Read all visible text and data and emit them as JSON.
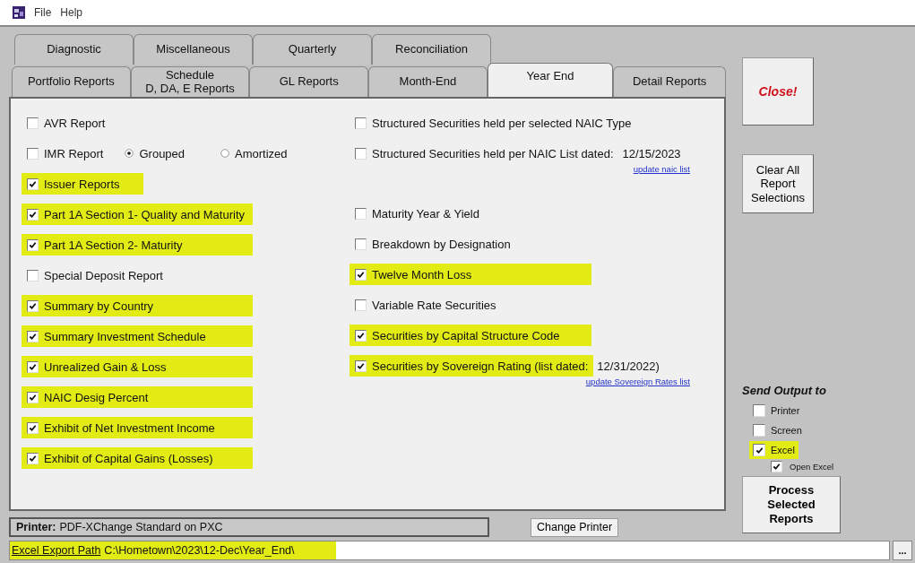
{
  "menu": [
    "File",
    "Help"
  ],
  "tabs": {
    "row_1": [
      {
        "label": "Diagnostic",
        "selected": false
      },
      {
        "label": "Miscellaneous",
        "selected": false
      },
      {
        "label": "Quarterly",
        "selected": false
      },
      {
        "label": "Reconciliation",
        "selected": false
      }
    ],
    "row_2": [
      {
        "label": "Portfolio Reports",
        "selected": false
      },
      {
        "label": "Schedule\nD, DA, E Reports",
        "selected": false
      },
      {
        "label": "GL Reports",
        "selected": false
      },
      {
        "label": "Month-End",
        "selected": false
      },
      {
        "label": "Year End",
        "selected": true
      },
      {
        "label": "Detail Reports",
        "selected": false
      }
    ]
  },
  "reports_left": [
    {
      "kind": "checkbox",
      "label": "AVR Report",
      "checked": false,
      "highlighted": false
    },
    {
      "kind": "radios",
      "label": "IMR Report",
      "checked": false,
      "highlighted": false,
      "options": [
        {
          "label": "Grouped",
          "selected": true
        },
        {
          "label": "Amortized",
          "selected": false
        }
      ]
    },
    {
      "kind": "checkbox",
      "label": "Issuer Reports",
      "checked": true,
      "highlighted": true
    },
    {
      "kind": "checkbox",
      "label": "Part 1A Section 1- Quality and Maturity",
      "checked": true,
      "highlighted": true
    },
    {
      "kind": "checkbox",
      "label": "Part 1A Section 2- Maturity",
      "checked": true,
      "highlighted": true
    },
    {
      "kind": "checkbox",
      "label": "Special Deposit Report",
      "checked": false,
      "highlighted": false
    },
    {
      "kind": "checkbox",
      "label": "Summary by Country",
      "checked": true,
      "highlighted": true
    },
    {
      "kind": "checkbox",
      "label": "Summary Investment Schedule",
      "checked": true,
      "highlighted": true
    },
    {
      "kind": "checkbox",
      "label": "Unrealized Gain & Loss",
      "checked": true,
      "highlighted": true
    },
    {
      "kind": "checkbox",
      "label": "NAIC Desig Percent",
      "checked": true,
      "highlighted": true
    },
    {
      "kind": "checkbox",
      "label": "Exhibit of Net Investment Income",
      "checked": true,
      "highlighted": true
    },
    {
      "kind": "checkbox",
      "label": "Exhibit of Capital Gains (Losses)",
      "checked": true,
      "highlighted": true
    }
  ],
  "reports_right": [
    {
      "kind": "checkbox",
      "label": "Structured Securities held per selected NAIC Type",
      "checked": false,
      "highlighted": false
    },
    {
      "kind": "checkbox",
      "label": "Structured Securities held per NAIC List dated:",
      "date": "12/15/2023",
      "link": "update naic list",
      "checked": false,
      "highlighted": false
    },
    {
      "kind": "checkbox",
      "label": "Maturity Year & Yield",
      "checked": false,
      "highlighted": false
    },
    {
      "kind": "checkbox",
      "label": "Breakdown by Designation",
      "checked": false,
      "highlighted": false
    },
    {
      "kind": "checkbox",
      "label": "Twelve Month Loss",
      "checked": true,
      "highlighted": true
    },
    {
      "kind": "checkbox",
      "label": "Variable Rate Securities",
      "checked": false,
      "highlighted": false
    },
    {
      "kind": "checkbox",
      "label": "Securities by Capital Structure Code",
      "checked": true,
      "highlighted": true
    },
    {
      "kind": "checkbox",
      "label": "Securities by Sovereign Rating (list dated:",
      "date": "12/31/2022)",
      "link": "update Sovereign Rates list",
      "checked": true,
      "highlighted": true
    }
  ],
  "close_button": "Close!",
  "clear_button": "Clear All\nReport\nSelections",
  "send_output": {
    "title": "Send Output to",
    "options": [
      {
        "label": "Printer",
        "checked": false,
        "highlighted": false
      },
      {
        "label": "Screen",
        "checked": false,
        "highlighted": false
      },
      {
        "label": "Excel",
        "checked": true,
        "highlighted": true
      }
    ],
    "sub_option": {
      "label": "Open Excel",
      "checked": true
    }
  },
  "process_button": "Process\nSelected\nReports",
  "printer": {
    "label": "Printer:",
    "value": "PDF-XChange Standard on PXC"
  },
  "change_printer_button": "Change Printer",
  "export_path": {
    "label": "Excel Export Path",
    "value": "C:\\Hometown\\2023\\12-Dec\\Year_End\\",
    "highlighted": true
  },
  "browse_button": "..."
}
